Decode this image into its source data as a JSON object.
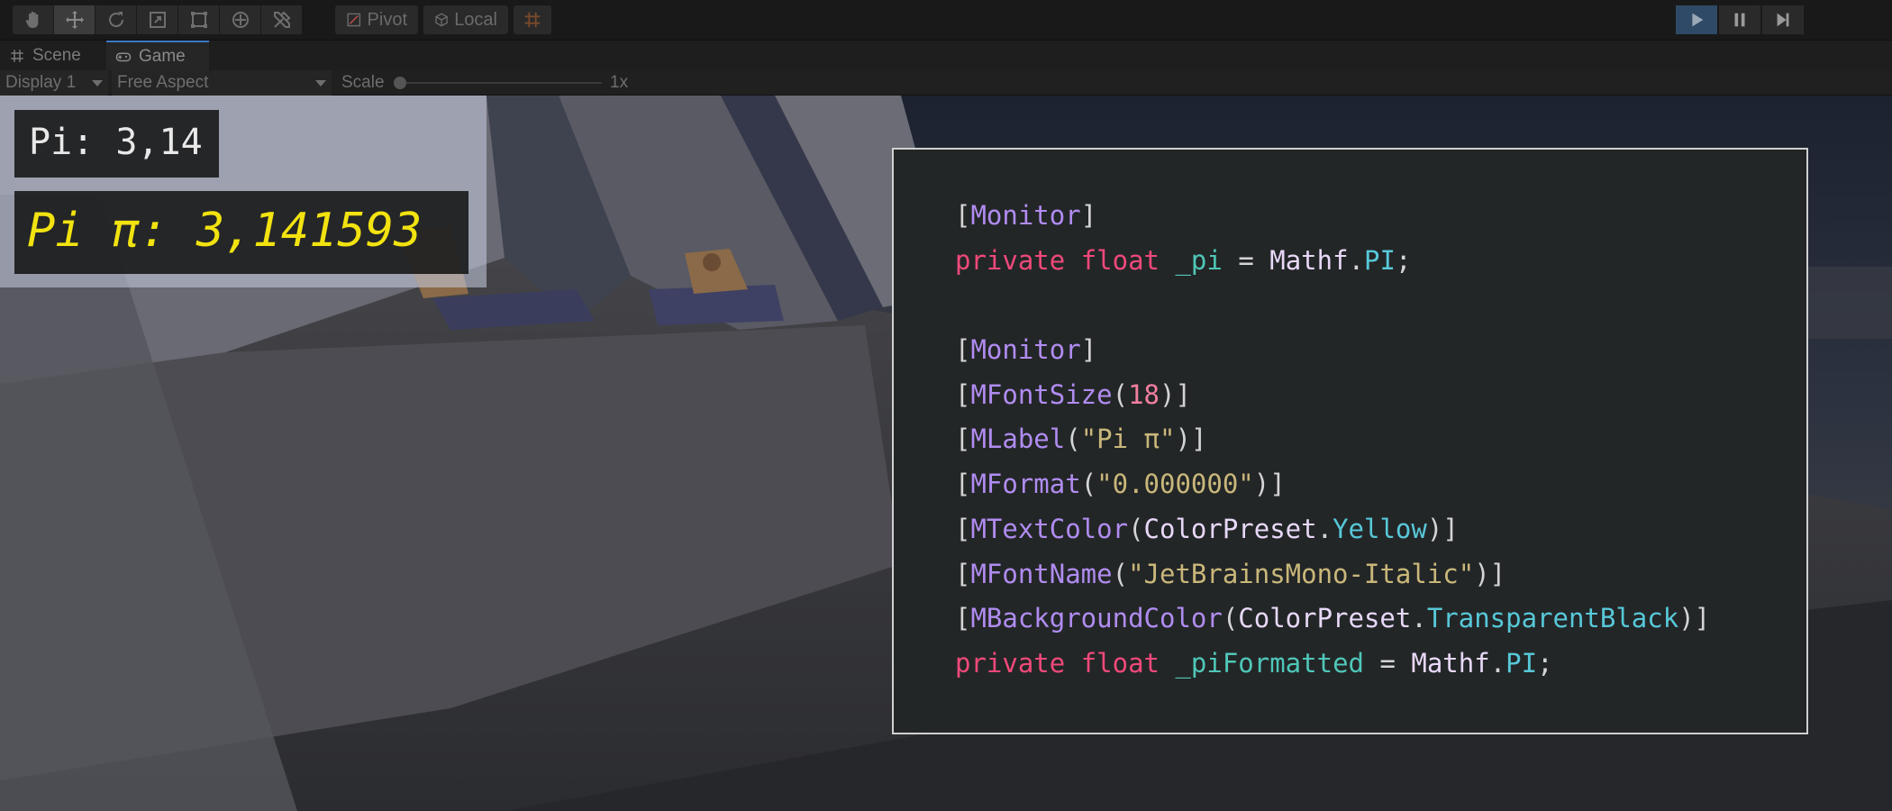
{
  "toolbar": {
    "tools": [
      {
        "name": "hand-tool",
        "icon": "hand-icon"
      },
      {
        "name": "move-tool",
        "icon": "move-icon"
      },
      {
        "name": "rotate-tool",
        "icon": "rotate-icon"
      },
      {
        "name": "scale-tool",
        "icon": "scale-icon"
      },
      {
        "name": "rect-tool",
        "icon": "rect-icon"
      },
      {
        "name": "transform-tool",
        "icon": "transform-icon"
      },
      {
        "name": "custom-tool",
        "icon": "tools-icon"
      }
    ],
    "pivot_label": "Pivot",
    "local_label": "Local",
    "grid_icon": "grid-snap-icon",
    "play_icon": "play-icon",
    "pause_icon": "pause-icon",
    "step_icon": "step-icon"
  },
  "tabs": [
    {
      "label": "Scene",
      "icon": "grid-icon",
      "active": false
    },
    {
      "label": "Game",
      "icon": "gamepad-icon",
      "active": true
    }
  ],
  "game_controls": {
    "display": "Display 1",
    "aspect": "Free Aspect",
    "scale_label": "Scale",
    "scale_value": "1x"
  },
  "monitor": {
    "pi": "Pi: 3,14",
    "pi_formatted": "Pi π: 3,141593",
    "pi_formatted_color": "#f2e310"
  },
  "code": {
    "line1": {
      "open": "[",
      "attr": "Monitor",
      "close": "]"
    },
    "line2": {
      "mod": "private",
      "type": "float",
      "field": "_pi",
      "eq": " = ",
      "cls": "Mathf",
      "dot": ".",
      "prop": "PI",
      "end": ";"
    },
    "line3": {
      "open": "[",
      "attr": "Monitor",
      "close": "]"
    },
    "line4": {
      "open": "[",
      "attr": "MFontSize",
      "lp": "(",
      "num": "18",
      "rp": ")",
      "close": "]"
    },
    "line5": {
      "open": "[",
      "attr": "MLabel",
      "lp": "(",
      "str": "\"Pi π\"",
      "rp": ")",
      "close": "]"
    },
    "line6": {
      "open": "[",
      "attr": "MFormat",
      "lp": "(",
      "str": "\"0.000000\"",
      "rp": ")",
      "close": "]"
    },
    "line7": {
      "open": "[",
      "attr": "MTextColor",
      "lp": "(",
      "cls": "ColorPreset",
      "dot": ".",
      "prop": "Yellow",
      "rp": ")",
      "close": "]"
    },
    "line8": {
      "open": "[",
      "attr": "MFontName",
      "lp": "(",
      "str": "\"JetBrainsMono-Italic\"",
      "rp": ")",
      "close": "]"
    },
    "line9": {
      "open": "[",
      "attr": "MBackgroundColor",
      "lp": "(",
      "cls": "ColorPreset",
      "dot": ".",
      "prop": "TransparentBlack",
      "rp": ")",
      "close": "]"
    },
    "line10": {
      "mod": "private",
      "type": "float",
      "field": "_piFormatted",
      "eq": " = ",
      "cls": "Mathf",
      "dot": ".",
      "prop": "PI",
      "end": ";"
    }
  }
}
